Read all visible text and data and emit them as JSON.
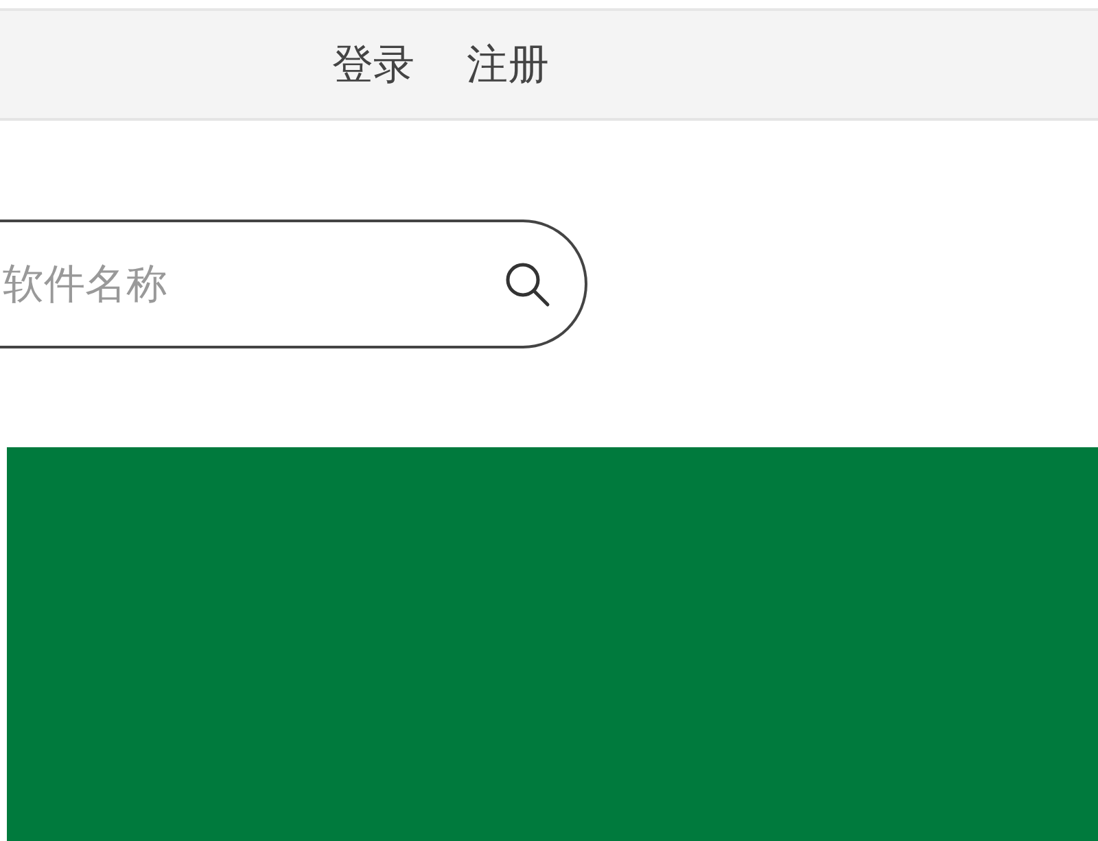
{
  "header": {
    "links": [
      "登录",
      "注册"
    ]
  },
  "search": {
    "placeholder": "软件名称"
  }
}
